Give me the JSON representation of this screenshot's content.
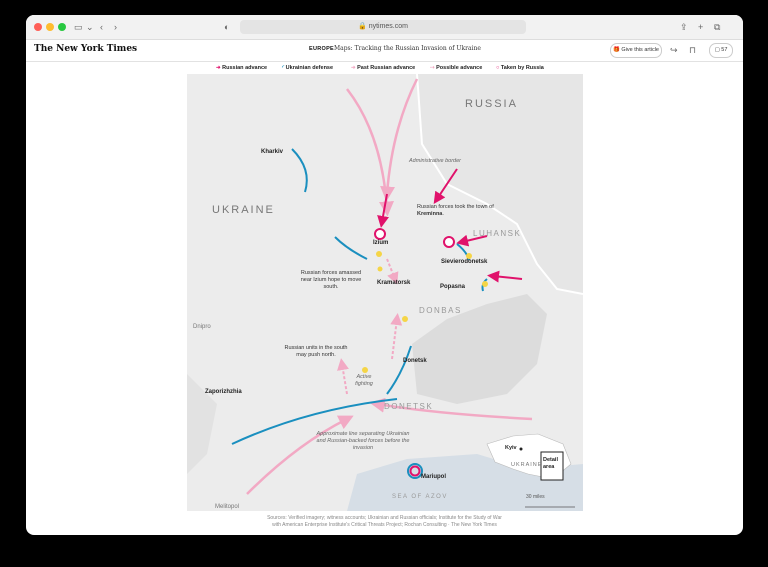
{
  "browser": {
    "url": "nytimes.com",
    "colors": {
      "close": "#ff5f57",
      "minimize": "#febc2e",
      "zoom": "#28c840"
    }
  },
  "header": {
    "logo": "The New York Times",
    "section": "EUROPE",
    "headline": "Maps: Tracking the Russian Invasion of Ukraine",
    "share_label": "Give this article",
    "comments_count": "57"
  },
  "legend": [
    {
      "label": "Russian advance",
      "color": "#e0126b",
      "icon": "arrow-icon"
    },
    {
      "label": "Ukrainian defense",
      "color": "#1a8fbf",
      "icon": "arc-icon"
    },
    {
      "label": "Past Russian advance",
      "color": "#f2a9c4",
      "icon": "arrow-icon"
    },
    {
      "label": "Possible advance",
      "color": "#f2a9c4",
      "icon": "dashed-arrow-icon"
    },
    {
      "label": "Taken by Russia",
      "color": "#e0126b",
      "icon": "ring-icon"
    }
  ],
  "map": {
    "countries": {
      "russia": "RUSSIA",
      "ukraine": "UKRAINE"
    },
    "regions": {
      "luhansk": "LUHANSK",
      "donbas": "DONBAS",
      "donetsk": "DONETSK"
    },
    "sea": "SEA OF AZOV",
    "cities": {
      "kharkiv": "Kharkiv",
      "izium": "Izium",
      "kramatorsk": "Kramatorsk",
      "sievierodonetsk": "Sievierodonetsk",
      "popasna": "Popasna",
      "donetsk": "Donetsk",
      "zaporizhzhia": "Zaporizhzhia",
      "mariupol": "Mariupol",
      "dnipro": "Dnipro",
      "melitopol": "Melitopol"
    },
    "notes": {
      "admin_border": "Administrative border",
      "kreminna_pre": "Russian forces took the town of ",
      "kreminna_bold": "Kreminna",
      "kreminna_post": ".",
      "izium_forces": "Russian forces amassed near Izium hope to move south.",
      "south_units": "Russian units in the south may push north.",
      "active_fighting": "Active fighting",
      "line": "Approximate line separating Ukrainian and Russian-backed forces before the invasion"
    },
    "inset": {
      "city": "Kyiv",
      "country": "UKRAINE",
      "box_label": "Detail area"
    },
    "scale": "30 miles",
    "colors": {
      "russian_advance": "#e0126b",
      "ukrainian_defense": "#1a8fbf",
      "past_advance": "#f2a9c4",
      "fighting": "#f5d547",
      "land": "#ececec",
      "sea": "#d6dee6",
      "controlled": "#dcdcdc"
    }
  },
  "sources": {
    "line1": "Sources: Verified imagery; witness accounts; Ukrainian and Russian officials; Institute for the Study of War",
    "line2": "with American Enterprise Institute's Critical Threats Project; Rochan Consulting  ·  The New York Times"
  }
}
